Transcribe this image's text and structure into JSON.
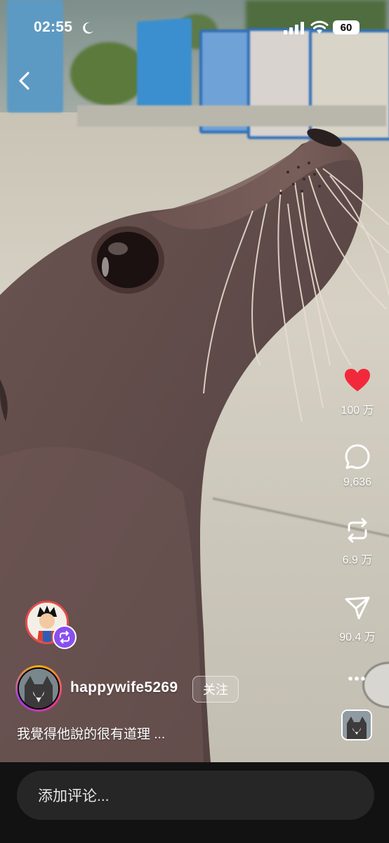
{
  "status_bar": {
    "time": "02:55",
    "battery": "60"
  },
  "actions": {
    "like_count": "100 万",
    "comment_count": "9,636",
    "repost_count": "6.9 万",
    "share_count": "90.4 万"
  },
  "post": {
    "username": "happywife5269",
    "follow_label": "关注",
    "caption": "我覺得他說的很有道理 ..."
  },
  "comment_bar": {
    "placeholder": "添加评论..."
  },
  "colors": {
    "like": "#f2293a",
    "repost_badge": "#8a4ff0"
  },
  "icons": [
    "moon-icon",
    "signal-icon",
    "wifi-icon",
    "battery-icon",
    "back-icon",
    "heart-icon",
    "comment-icon",
    "repost-icon",
    "share-icon",
    "more-icon"
  ]
}
